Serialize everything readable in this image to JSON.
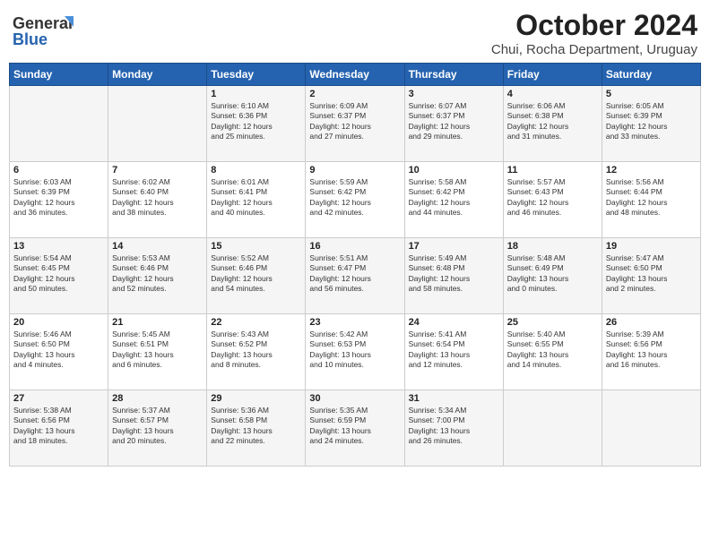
{
  "logo": {
    "line1": "General",
    "line2": "Blue"
  },
  "title": "October 2024",
  "subtitle": "Chui, Rocha Department, Uruguay",
  "weekdays": [
    "Sunday",
    "Monday",
    "Tuesday",
    "Wednesday",
    "Thursday",
    "Friday",
    "Saturday"
  ],
  "weeks": [
    [
      {
        "day": "",
        "info": ""
      },
      {
        "day": "",
        "info": ""
      },
      {
        "day": "1",
        "info": "Sunrise: 6:10 AM\nSunset: 6:36 PM\nDaylight: 12 hours\nand 25 minutes."
      },
      {
        "day": "2",
        "info": "Sunrise: 6:09 AM\nSunset: 6:37 PM\nDaylight: 12 hours\nand 27 minutes."
      },
      {
        "day": "3",
        "info": "Sunrise: 6:07 AM\nSunset: 6:37 PM\nDaylight: 12 hours\nand 29 minutes."
      },
      {
        "day": "4",
        "info": "Sunrise: 6:06 AM\nSunset: 6:38 PM\nDaylight: 12 hours\nand 31 minutes."
      },
      {
        "day": "5",
        "info": "Sunrise: 6:05 AM\nSunset: 6:39 PM\nDaylight: 12 hours\nand 33 minutes."
      }
    ],
    [
      {
        "day": "6",
        "info": "Sunrise: 6:03 AM\nSunset: 6:39 PM\nDaylight: 12 hours\nand 36 minutes."
      },
      {
        "day": "7",
        "info": "Sunrise: 6:02 AM\nSunset: 6:40 PM\nDaylight: 12 hours\nand 38 minutes."
      },
      {
        "day": "8",
        "info": "Sunrise: 6:01 AM\nSunset: 6:41 PM\nDaylight: 12 hours\nand 40 minutes."
      },
      {
        "day": "9",
        "info": "Sunrise: 5:59 AM\nSunset: 6:42 PM\nDaylight: 12 hours\nand 42 minutes."
      },
      {
        "day": "10",
        "info": "Sunrise: 5:58 AM\nSunset: 6:42 PM\nDaylight: 12 hours\nand 44 minutes."
      },
      {
        "day": "11",
        "info": "Sunrise: 5:57 AM\nSunset: 6:43 PM\nDaylight: 12 hours\nand 46 minutes."
      },
      {
        "day": "12",
        "info": "Sunrise: 5:56 AM\nSunset: 6:44 PM\nDaylight: 12 hours\nand 48 minutes."
      }
    ],
    [
      {
        "day": "13",
        "info": "Sunrise: 5:54 AM\nSunset: 6:45 PM\nDaylight: 12 hours\nand 50 minutes."
      },
      {
        "day": "14",
        "info": "Sunrise: 5:53 AM\nSunset: 6:46 PM\nDaylight: 12 hours\nand 52 minutes."
      },
      {
        "day": "15",
        "info": "Sunrise: 5:52 AM\nSunset: 6:46 PM\nDaylight: 12 hours\nand 54 minutes."
      },
      {
        "day": "16",
        "info": "Sunrise: 5:51 AM\nSunset: 6:47 PM\nDaylight: 12 hours\nand 56 minutes."
      },
      {
        "day": "17",
        "info": "Sunrise: 5:49 AM\nSunset: 6:48 PM\nDaylight: 12 hours\nand 58 minutes."
      },
      {
        "day": "18",
        "info": "Sunrise: 5:48 AM\nSunset: 6:49 PM\nDaylight: 13 hours\nand 0 minutes."
      },
      {
        "day": "19",
        "info": "Sunrise: 5:47 AM\nSunset: 6:50 PM\nDaylight: 13 hours\nand 2 minutes."
      }
    ],
    [
      {
        "day": "20",
        "info": "Sunrise: 5:46 AM\nSunset: 6:50 PM\nDaylight: 13 hours\nand 4 minutes."
      },
      {
        "day": "21",
        "info": "Sunrise: 5:45 AM\nSunset: 6:51 PM\nDaylight: 13 hours\nand 6 minutes."
      },
      {
        "day": "22",
        "info": "Sunrise: 5:43 AM\nSunset: 6:52 PM\nDaylight: 13 hours\nand 8 minutes."
      },
      {
        "day": "23",
        "info": "Sunrise: 5:42 AM\nSunset: 6:53 PM\nDaylight: 13 hours\nand 10 minutes."
      },
      {
        "day": "24",
        "info": "Sunrise: 5:41 AM\nSunset: 6:54 PM\nDaylight: 13 hours\nand 12 minutes."
      },
      {
        "day": "25",
        "info": "Sunrise: 5:40 AM\nSunset: 6:55 PM\nDaylight: 13 hours\nand 14 minutes."
      },
      {
        "day": "26",
        "info": "Sunrise: 5:39 AM\nSunset: 6:56 PM\nDaylight: 13 hours\nand 16 minutes."
      }
    ],
    [
      {
        "day": "27",
        "info": "Sunrise: 5:38 AM\nSunset: 6:56 PM\nDaylight: 13 hours\nand 18 minutes."
      },
      {
        "day": "28",
        "info": "Sunrise: 5:37 AM\nSunset: 6:57 PM\nDaylight: 13 hours\nand 20 minutes."
      },
      {
        "day": "29",
        "info": "Sunrise: 5:36 AM\nSunset: 6:58 PM\nDaylight: 13 hours\nand 22 minutes."
      },
      {
        "day": "30",
        "info": "Sunrise: 5:35 AM\nSunset: 6:59 PM\nDaylight: 13 hours\nand 24 minutes."
      },
      {
        "day": "31",
        "info": "Sunrise: 5:34 AM\nSunset: 7:00 PM\nDaylight: 13 hours\nand 26 minutes."
      },
      {
        "day": "",
        "info": ""
      },
      {
        "day": "",
        "info": ""
      }
    ]
  ]
}
